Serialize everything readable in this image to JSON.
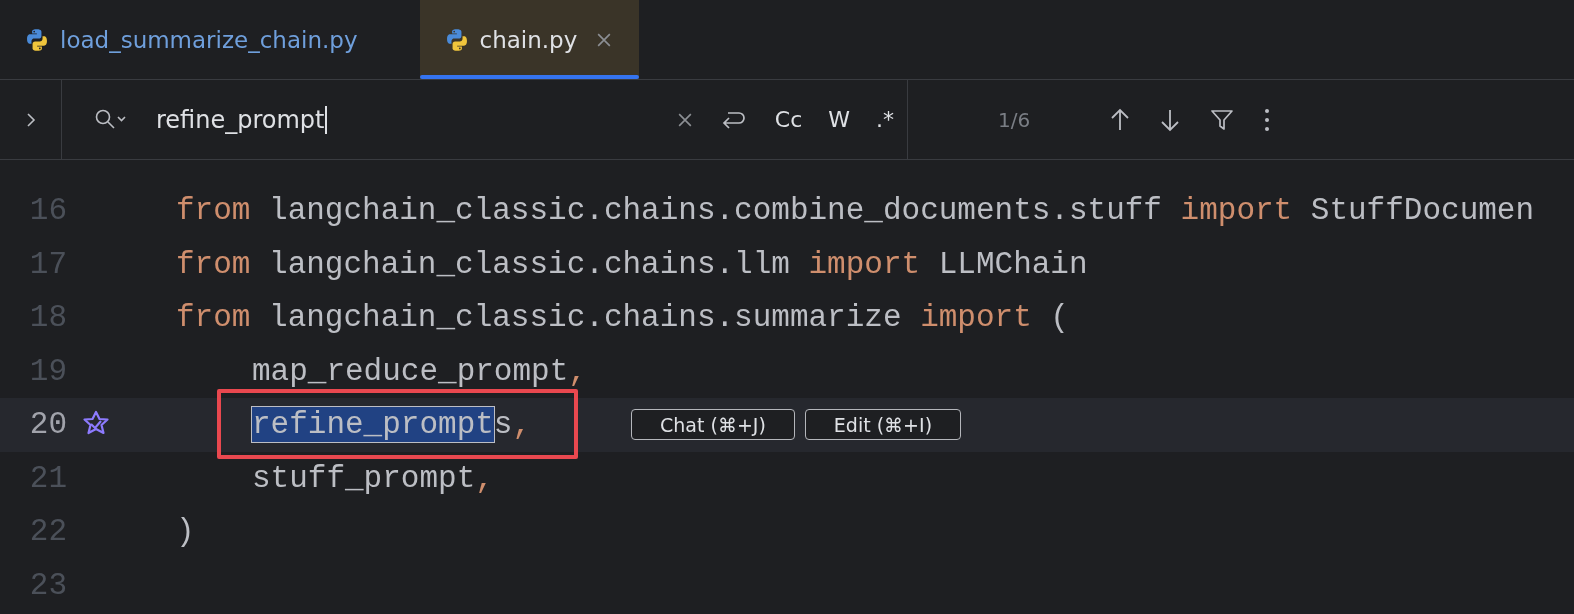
{
  "tabs": [
    {
      "label": "load_summarize_chain.py",
      "selected": false
    },
    {
      "label": "chain.py",
      "selected": true
    }
  ],
  "search": {
    "value": "refine_prompt",
    "toggles": [
      "Cc",
      "W",
      ".*"
    ],
    "match_count": "1/6"
  },
  "lines": [
    {
      "number": "16",
      "current": false,
      "tokens": [
        {
          "kind": "keyword",
          "text": "from"
        },
        {
          "kind": "plain",
          "text": " langchain_classic.chains.combine_documents.stuff "
        },
        {
          "kind": "keyword",
          "text": "import"
        },
        {
          "kind": "plain",
          "text": " StuffDocumen"
        }
      ]
    },
    {
      "number": "17",
      "current": false,
      "tokens": [
        {
          "kind": "keyword",
          "text": "from"
        },
        {
          "kind": "plain",
          "text": " langchain_classic.chains.llm "
        },
        {
          "kind": "keyword",
          "text": "import"
        },
        {
          "kind": "plain",
          "text": " LLMChain"
        }
      ]
    },
    {
      "number": "18",
      "current": false,
      "tokens": [
        {
          "kind": "keyword",
          "text": "from"
        },
        {
          "kind": "plain",
          "text": " langchain_classic.chains.summarize "
        },
        {
          "kind": "keyword",
          "text": "import"
        },
        {
          "kind": "plain",
          "text": " ("
        }
      ]
    },
    {
      "number": "19",
      "current": false,
      "indent": true,
      "tokens": [
        {
          "kind": "plain",
          "text": "map_reduce_prompt"
        },
        {
          "kind": "punct",
          "text": ","
        }
      ]
    },
    {
      "number": "20",
      "current": true,
      "gutter_icon": true,
      "indent": true,
      "tokens": [
        {
          "kind": "selection",
          "text": "refine_prompt"
        },
        {
          "kind": "plain",
          "text": "s"
        },
        {
          "kind": "punct",
          "text": ","
        }
      ],
      "actions": [
        "Chat (⌘+J)",
        "Edit (⌘+I)"
      ]
    },
    {
      "number": "21",
      "current": false,
      "indent": true,
      "tokens": [
        {
          "kind": "plain",
          "text": "stuff_prompt"
        },
        {
          "kind": "punct",
          "text": ","
        }
      ]
    },
    {
      "number": "22",
      "current": false,
      "tokens": [
        {
          "kind": "plain",
          "text": ")"
        }
      ]
    },
    {
      "number": "23",
      "current": false
    }
  ],
  "highlight_box": true
}
